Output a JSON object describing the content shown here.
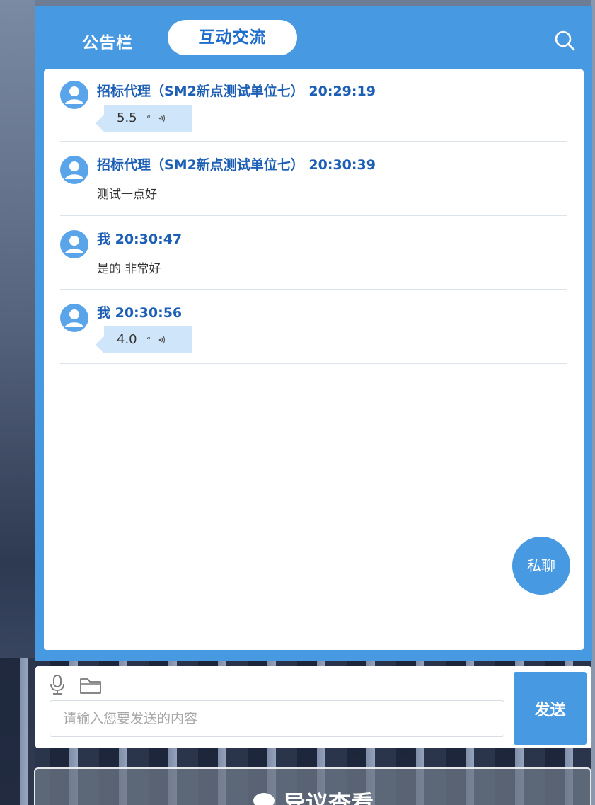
{
  "tabs": {
    "notice_label": "公告栏",
    "interact_label": "互动交流"
  },
  "messages": [
    {
      "sender": "招标代理（SM2新点测试单位七） 20:29:19",
      "type": "voice",
      "content": "5.5"
    },
    {
      "sender": "招标代理（SM2新点测试单位七） 20:30:39",
      "type": "text",
      "content": "测试一点好"
    },
    {
      "sender": "我 20:30:47",
      "type": "text",
      "content": "是的 非常好"
    },
    {
      "sender": "我 20:30:56",
      "type": "voice",
      "content": "4.0"
    }
  ],
  "voice_mark": "“",
  "private_chat_label": "私聊",
  "input": {
    "placeholder": "请输入您要发送的内容",
    "value": ""
  },
  "send_label": "发送",
  "objection_label": "异议查看",
  "colors": {
    "primary": "#4799e2",
    "sender_text": "#1d5fb4",
    "voice_bubble": "#cfe6fa"
  }
}
